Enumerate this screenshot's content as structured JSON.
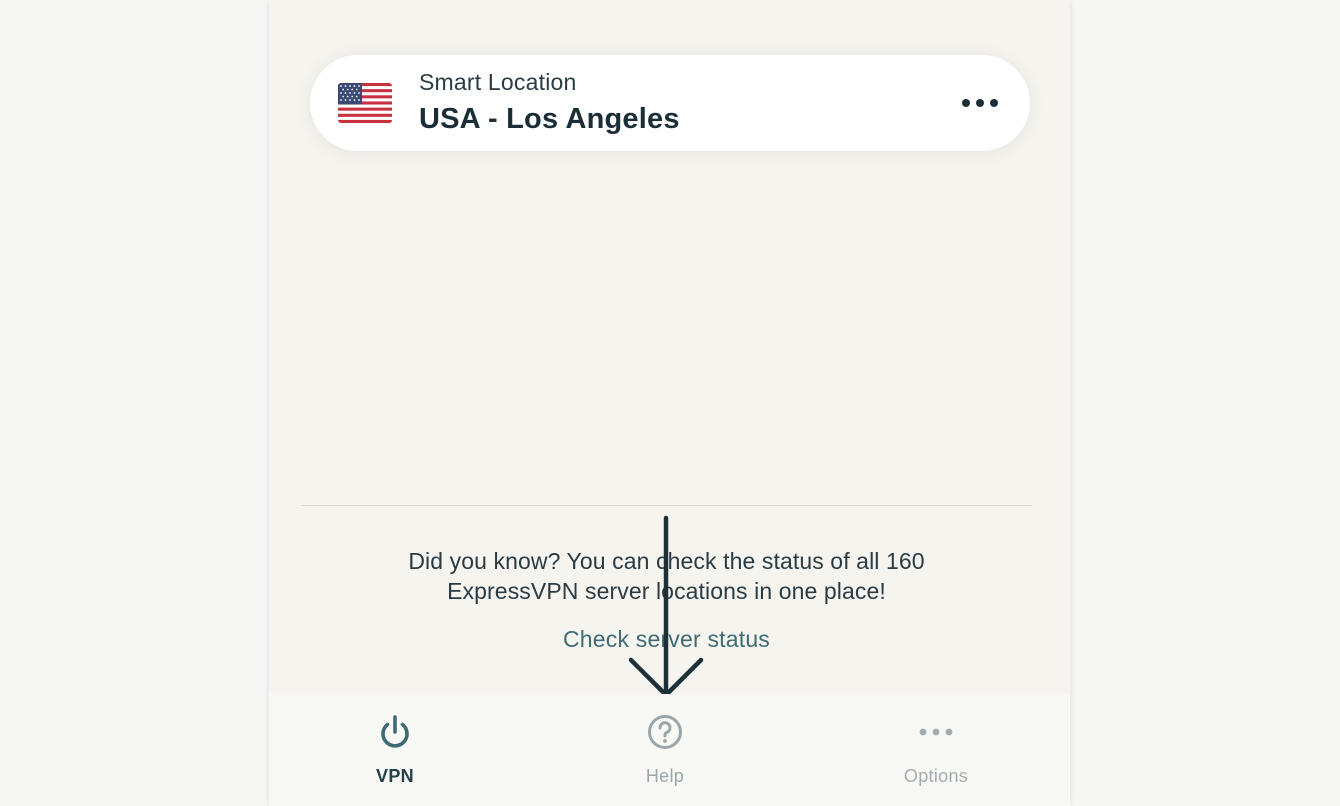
{
  "location_card": {
    "subtitle": "Smart Location",
    "location": "USA - Los Angeles",
    "flag_icon": "us-flag-icon",
    "more_icon": "more-horizontal-icon"
  },
  "tip": {
    "line1": "Did you know? You can check the status of all 160",
    "line2": "ExpressVPN server locations in one place!",
    "link_label": "Check server status"
  },
  "tabs": [
    {
      "label": "VPN",
      "icon": "power-icon",
      "active": true
    },
    {
      "label": "Help",
      "icon": "help-circle-icon",
      "active": false
    },
    {
      "label": "Options",
      "icon": "more-horizontal-icon",
      "active": false
    }
  ],
  "colors": {
    "app_background": "#f5f4ef",
    "card_background": "#ffffff",
    "primary_text": "#1b2d36",
    "link": "#3f6b73",
    "tab_active": "#22414b",
    "tab_inactive": "#9aa6aa",
    "annotation_arrow": "#1d3038"
  }
}
